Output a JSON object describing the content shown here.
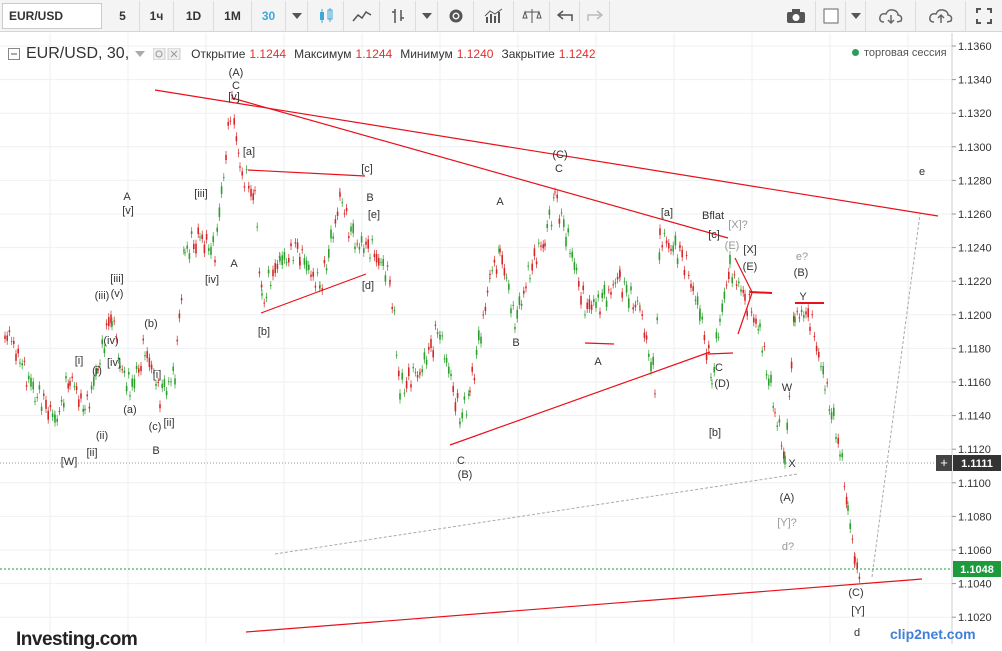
{
  "toolbar": {
    "symbol": "EUR/USD",
    "intervals": [
      "5",
      "1ч",
      "1D",
      "1M",
      "30"
    ],
    "active_interval": "30"
  },
  "legend": {
    "title": "EUR/USD, 30,",
    "open_label": "Открытие",
    "open_value": "1.1244",
    "high_label": "Максимум",
    "high_value": "1.1244",
    "low_label": "Минимум",
    "low_value": "1.1240",
    "close_label": "Закрытие",
    "close_value": "1.1242"
  },
  "session_label": "торговая сессия",
  "price_axis": {
    "ticks": [
      "1.1360",
      "1.1340",
      "1.1320",
      "1.1300",
      "1.1280",
      "1.1260",
      "1.1240",
      "1.1220",
      "1.1200",
      "1.1180",
      "1.1160",
      "1.1140",
      "1.1120",
      "1.1100",
      "1.1080",
      "1.1060",
      "1.1040",
      "1.1020"
    ],
    "crosshair_price": "1.1111",
    "current_price": "1.1048"
  },
  "wave_labels": [
    {
      "t": "(A)"
    },
    {
      "t": "C"
    },
    {
      "t": "[v]"
    },
    {
      "t": "[a]"
    },
    {
      "t": "[c]"
    },
    {
      "t": "B"
    },
    {
      "t": "[e]"
    },
    {
      "t": "[iii]"
    },
    {
      "t": "A"
    },
    {
      "t": "[v]"
    },
    {
      "t": "[iv]"
    },
    {
      "t": "A"
    },
    {
      "t": "[d]"
    },
    {
      "t": "[b]"
    },
    {
      "t": "[iii]"
    },
    {
      "t": "(iii)"
    },
    {
      "t": "(v)"
    },
    {
      "t": "(iv)"
    },
    {
      "t": "(b)"
    },
    {
      "t": "[iv]"
    },
    {
      "t": "[i]"
    },
    {
      "t": "(i)"
    },
    {
      "t": "[i]"
    },
    {
      "t": "(a)"
    },
    {
      "t": "(c)"
    },
    {
      "t": "[ii]"
    },
    {
      "t": "(ii)"
    },
    {
      "t": "[ii]"
    },
    {
      "t": "[W]"
    },
    {
      "t": "B"
    },
    {
      "t": "(C)"
    },
    {
      "t": "C"
    },
    {
      "t": "A"
    },
    {
      "t": "B"
    },
    {
      "t": "C"
    },
    {
      "t": "(B)"
    },
    {
      "t": "[a]"
    },
    {
      "t": "A"
    },
    {
      "t": "Bflat"
    },
    {
      "t": "[X]?"
    },
    {
      "t": "[c]"
    },
    {
      "t": "(E)"
    },
    {
      "t": "[X]"
    },
    {
      "t": "(E)"
    },
    {
      "t": "C"
    },
    {
      "t": "(D)"
    },
    {
      "t": "[b]"
    },
    {
      "t": "e?"
    },
    {
      "t": "(B)"
    },
    {
      "t": "Y"
    },
    {
      "t": "W"
    },
    {
      "t": "X"
    },
    {
      "t": "(A)"
    },
    {
      "t": "[Y]?"
    },
    {
      "t": "d?"
    },
    {
      "t": "(C)"
    },
    {
      "t": "[Y]"
    },
    {
      "t": "d"
    },
    {
      "t": "e"
    }
  ],
  "branding": {
    "logo": "Investing.com",
    "watermark": "clip2net.com"
  },
  "colors": {
    "up": "#2ca02c",
    "down": "#d62728",
    "trendline": "#e8101a",
    "accent": "#3ea9d8",
    "current_price_bg": "#1d9a3b",
    "crosshair_bg": "#333333"
  }
}
